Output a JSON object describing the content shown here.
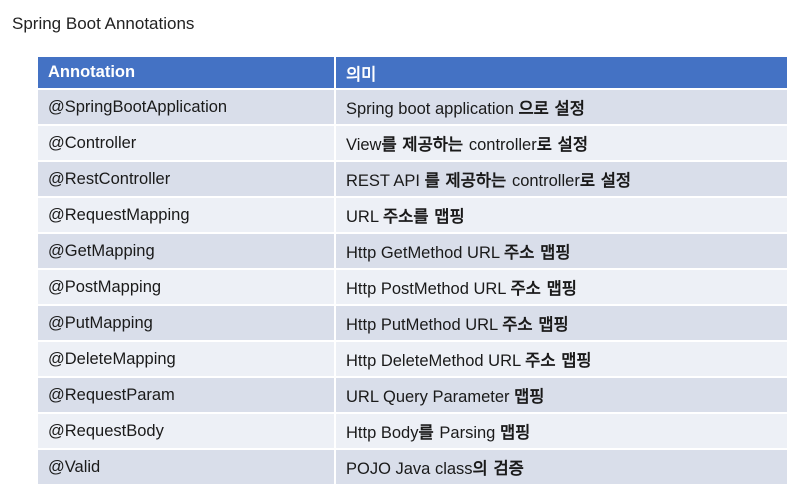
{
  "title": "Spring Boot Annotations",
  "table": {
    "headers": [
      "Annotation",
      "의미"
    ],
    "rows": [
      {
        "annotation": "@SpringBootApplication",
        "meaning": [
          {
            "t": "Spring boot application ",
            "b": false
          },
          {
            "t": "으로 설정",
            "b": true
          }
        ]
      },
      {
        "annotation": "@Controller",
        "meaning": [
          {
            "t": "View",
            "b": false
          },
          {
            "t": "를 제공하는 ",
            "b": true
          },
          {
            "t": "controller",
            "b": false
          },
          {
            "t": "로 설정",
            "b": true
          }
        ]
      },
      {
        "annotation": "@RestController",
        "meaning": [
          {
            "t": "REST API ",
            "b": false
          },
          {
            "t": "를 제공하는 ",
            "b": true
          },
          {
            "t": "controller",
            "b": false
          },
          {
            "t": "로 설정",
            "b": true
          }
        ]
      },
      {
        "annotation": "@RequestMapping",
        "meaning": [
          {
            "t": "URL ",
            "b": false
          },
          {
            "t": "주소를 맵핑",
            "b": true
          }
        ]
      },
      {
        "annotation": "@GetMapping",
        "meaning": [
          {
            "t": "Http GetMethod URL ",
            "b": false
          },
          {
            "t": "주소 맵핑",
            "b": true
          }
        ]
      },
      {
        "annotation": "@PostMapping",
        "meaning": [
          {
            "t": "Http PostMethod URL ",
            "b": false
          },
          {
            "t": "주소 맵핑",
            "b": true
          }
        ]
      },
      {
        "annotation": "@PutMapping",
        "meaning": [
          {
            "t": "Http PutMethod URL ",
            "b": false
          },
          {
            "t": "주소 맵핑",
            "b": true
          }
        ]
      },
      {
        "annotation": "@DeleteMapping",
        "meaning": [
          {
            "t": "Http DeleteMethod URL ",
            "b": false
          },
          {
            "t": "주소 맵핑",
            "b": true
          }
        ]
      },
      {
        "annotation": "@RequestParam",
        "meaning": [
          {
            "t": "URL Query Parameter ",
            "b": false
          },
          {
            "t": "맵핑",
            "b": true
          }
        ]
      },
      {
        "annotation": "@RequestBody",
        "meaning": [
          {
            "t": "Http Body",
            "b": false
          },
          {
            "t": "를 ",
            "b": true
          },
          {
            "t": "Parsing ",
            "b": false
          },
          {
            "t": "맵핑",
            "b": true
          }
        ]
      },
      {
        "annotation": "@Valid",
        "meaning": [
          {
            "t": "POJO Java class",
            "b": false
          },
          {
            "t": "의 검증",
            "b": true
          }
        ]
      }
    ]
  },
  "colors": {
    "header_bg": "#4472c4",
    "row_dark": "#d9deea",
    "row_light": "#edf0f6"
  }
}
